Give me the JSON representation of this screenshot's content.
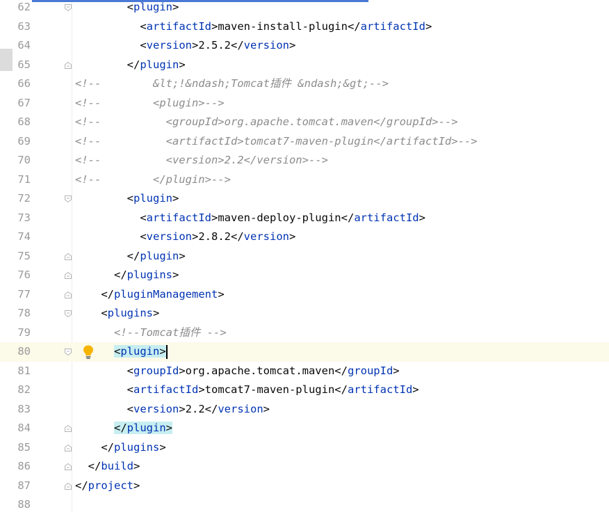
{
  "editor": {
    "current_line": 80,
    "lines": [
      {
        "num": "62",
        "indent": "        ",
        "parts": [
          {
            "t": "<",
            "c": "txt"
          },
          {
            "t": "plugin",
            "c": "tag"
          },
          {
            "t": ">",
            "c": "txt"
          }
        ],
        "fold": "open"
      },
      {
        "num": "63",
        "indent": "          ",
        "parts": [
          {
            "t": "<",
            "c": "txt"
          },
          {
            "t": "artifactId",
            "c": "tag"
          },
          {
            "t": ">maven-install-plugin</",
            "c": "txt"
          },
          {
            "t": "artifactId",
            "c": "tag"
          },
          {
            "t": ">",
            "c": "txt"
          }
        ]
      },
      {
        "num": "64",
        "indent": "          ",
        "parts": [
          {
            "t": "<",
            "c": "txt"
          },
          {
            "t": "version",
            "c": "tag"
          },
          {
            "t": ">2.5.2</",
            "c": "txt"
          },
          {
            "t": "version",
            "c": "tag"
          },
          {
            "t": ">",
            "c": "txt"
          }
        ]
      },
      {
        "num": "65",
        "indent": "        ",
        "parts": [
          {
            "t": "</",
            "c": "txt"
          },
          {
            "t": "plugin",
            "c": "tag"
          },
          {
            "t": ">",
            "c": "txt"
          }
        ],
        "fold": "close"
      },
      {
        "num": "66",
        "indent": "",
        "parts": [
          {
            "t": "<!--        &lt;!&ndash;Tomcat插件 &ndash;&gt;-->",
            "c": "cm"
          }
        ]
      },
      {
        "num": "67",
        "indent": "",
        "parts": [
          {
            "t": "<!--        <plugin>-->",
            "c": "cm"
          }
        ]
      },
      {
        "num": "68",
        "indent": "",
        "parts": [
          {
            "t": "<!--          <groupId>org.apache.tomcat.maven</groupId>-->",
            "c": "cm"
          }
        ]
      },
      {
        "num": "69",
        "indent": "",
        "parts": [
          {
            "t": "<!--          <artifactId>tomcat7-maven-plugin</artifactId>-->",
            "c": "cm"
          }
        ]
      },
      {
        "num": "70",
        "indent": "",
        "parts": [
          {
            "t": "<!--          <version>2.2</version>-->",
            "c": "cm"
          }
        ]
      },
      {
        "num": "71",
        "indent": "",
        "parts": [
          {
            "t": "<!--        </plugin>-->",
            "c": "cm"
          }
        ]
      },
      {
        "num": "72",
        "indent": "        ",
        "parts": [
          {
            "t": "<",
            "c": "txt"
          },
          {
            "t": "plugin",
            "c": "tag"
          },
          {
            "t": ">",
            "c": "txt"
          }
        ],
        "fold": "open"
      },
      {
        "num": "73",
        "indent": "          ",
        "parts": [
          {
            "t": "<",
            "c": "txt"
          },
          {
            "t": "artifactId",
            "c": "tag"
          },
          {
            "t": ">maven-deploy-plugin</",
            "c": "txt"
          },
          {
            "t": "artifactId",
            "c": "tag"
          },
          {
            "t": ">",
            "c": "txt"
          }
        ]
      },
      {
        "num": "74",
        "indent": "          ",
        "parts": [
          {
            "t": "<",
            "c": "txt"
          },
          {
            "t": "version",
            "c": "tag"
          },
          {
            "t": ">2.8.2</",
            "c": "txt"
          },
          {
            "t": "version",
            "c": "tag"
          },
          {
            "t": ">",
            "c": "txt"
          }
        ]
      },
      {
        "num": "75",
        "indent": "        ",
        "parts": [
          {
            "t": "</",
            "c": "txt"
          },
          {
            "t": "plugin",
            "c": "tag"
          },
          {
            "t": ">",
            "c": "txt"
          }
        ],
        "fold": "close"
      },
      {
        "num": "76",
        "indent": "      ",
        "parts": [
          {
            "t": "</",
            "c": "txt"
          },
          {
            "t": "plugins",
            "c": "tag"
          },
          {
            "t": ">",
            "c": "txt"
          }
        ],
        "fold": "close"
      },
      {
        "num": "77",
        "indent": "    ",
        "parts": [
          {
            "t": "</",
            "c": "txt"
          },
          {
            "t": "pluginManagement",
            "c": "tag"
          },
          {
            "t": ">",
            "c": "txt"
          }
        ],
        "fold": "close"
      },
      {
        "num": "78",
        "indent": "    ",
        "parts": [
          {
            "t": "<",
            "c": "txt"
          },
          {
            "t": "plugins",
            "c": "tag"
          },
          {
            "t": ">",
            "c": "txt"
          }
        ],
        "fold": "open"
      },
      {
        "num": "79",
        "indent": "      ",
        "parts": [
          {
            "t": "<!--Tomcat插件 -->",
            "c": "cm"
          }
        ]
      },
      {
        "num": "80",
        "indent": "      ",
        "parts": [
          {
            "t": "<",
            "c": "txt hl"
          },
          {
            "t": "plugin",
            "c": "tag hl"
          },
          {
            "t": ">",
            "c": "txt hl"
          }
        ],
        "fold": "open",
        "bulb": true,
        "caret": true
      },
      {
        "num": "81",
        "indent": "        ",
        "parts": [
          {
            "t": "<",
            "c": "txt"
          },
          {
            "t": "groupId",
            "c": "tag"
          },
          {
            "t": ">org.apache.tomcat.maven</",
            "c": "txt"
          },
          {
            "t": "groupId",
            "c": "tag"
          },
          {
            "t": ">",
            "c": "txt"
          }
        ]
      },
      {
        "num": "82",
        "indent": "        ",
        "parts": [
          {
            "t": "<",
            "c": "txt"
          },
          {
            "t": "artifactId",
            "c": "tag"
          },
          {
            "t": ">tomcat7-maven-plugin</",
            "c": "txt"
          },
          {
            "t": "artifactId",
            "c": "tag"
          },
          {
            "t": ">",
            "c": "txt"
          }
        ]
      },
      {
        "num": "83",
        "indent": "        ",
        "parts": [
          {
            "t": "<",
            "c": "txt"
          },
          {
            "t": "version",
            "c": "tag"
          },
          {
            "t": ">2.2</",
            "c": "txt"
          },
          {
            "t": "version",
            "c": "tag"
          },
          {
            "t": ">",
            "c": "txt"
          }
        ]
      },
      {
        "num": "84",
        "indent": "      ",
        "parts": [
          {
            "t": "</",
            "c": "txt hl"
          },
          {
            "t": "plugin",
            "c": "tag hl"
          },
          {
            "t": ">",
            "c": "txt hl"
          }
        ],
        "fold": "close"
      },
      {
        "num": "85",
        "indent": "    ",
        "parts": [
          {
            "t": "</",
            "c": "txt"
          },
          {
            "t": "plugins",
            "c": "tag"
          },
          {
            "t": ">",
            "c": "txt"
          }
        ],
        "fold": "close"
      },
      {
        "num": "86",
        "indent": "  ",
        "parts": [
          {
            "t": "</",
            "c": "txt"
          },
          {
            "t": "build",
            "c": "tag"
          },
          {
            "t": ">",
            "c": "txt"
          }
        ],
        "fold": "close"
      },
      {
        "num": "87",
        "indent": "",
        "parts": [
          {
            "t": "</",
            "c": "txt"
          },
          {
            "t": "project",
            "c": "tag"
          },
          {
            "t": ">",
            "c": "txt"
          }
        ],
        "fold": "close"
      },
      {
        "num": "88",
        "indent": "",
        "parts": []
      }
    ]
  },
  "colors": {
    "tag": "#0033b3",
    "text": "#080808",
    "comment": "#8c8c8c",
    "line_number": "#9a9a9a",
    "current_line_bg": "#fcfae9",
    "match_highlight": "#c7eef0",
    "bulb": "#f5b400"
  },
  "icons": {
    "fold_open": "fold-open-icon",
    "fold_close": "fold-close-icon",
    "intention": "lightbulb-icon"
  }
}
